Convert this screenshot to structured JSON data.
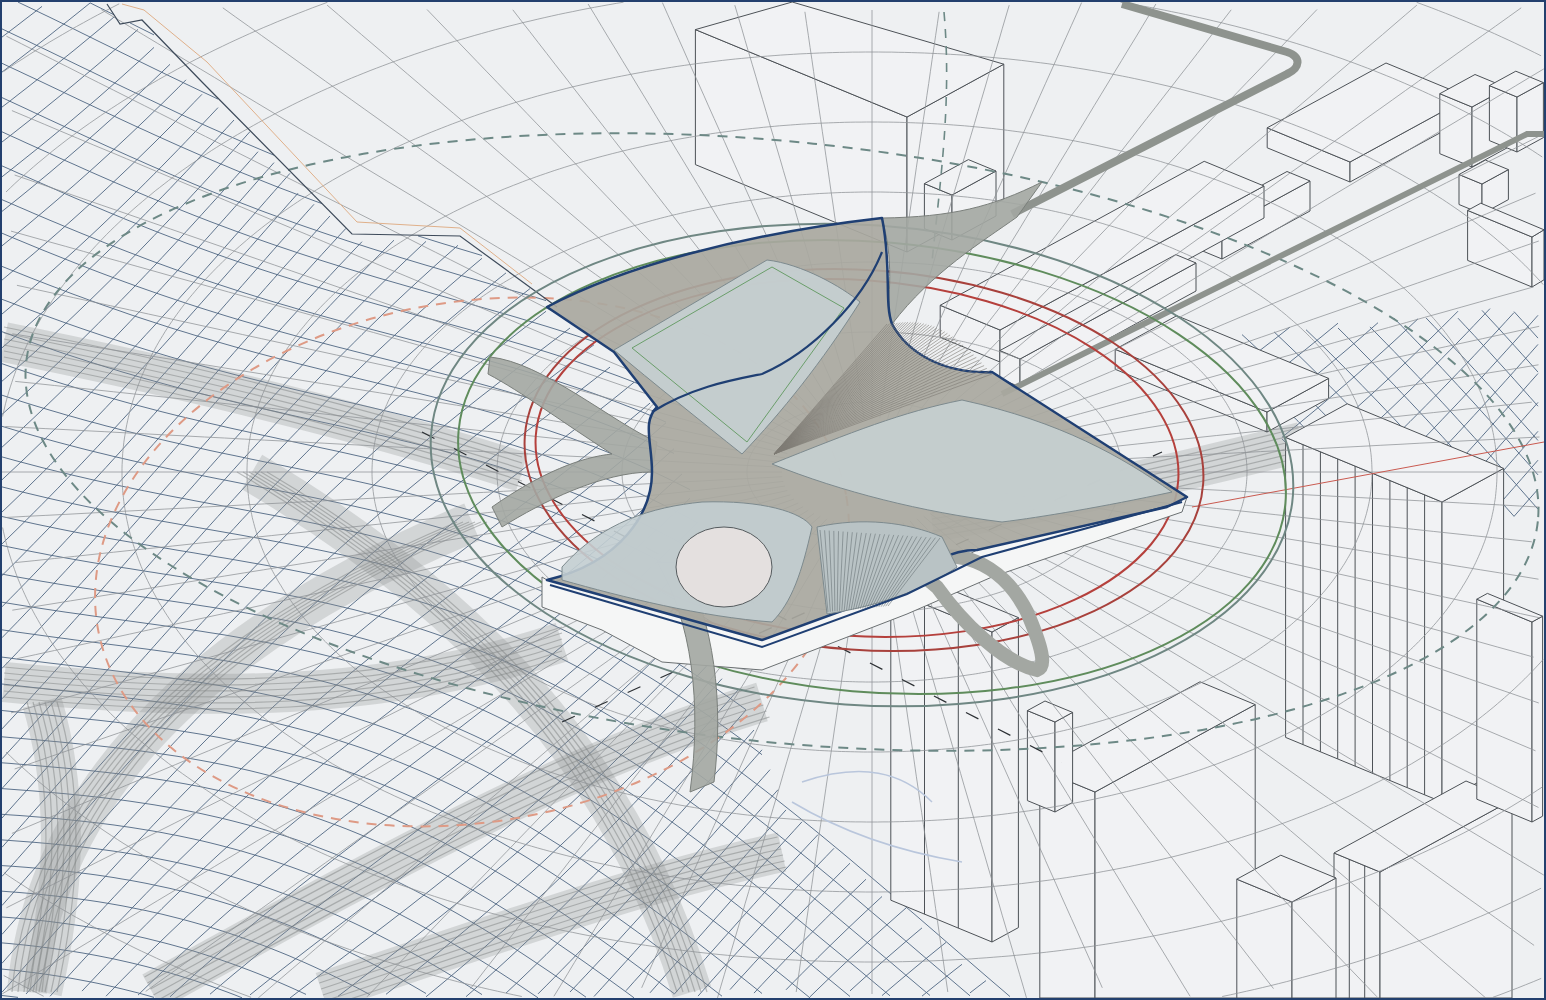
{
  "rings": [
    {
      "color": "#b5403c"
    },
    {
      "color": "#a8413c"
    },
    {
      "color": "#5f8c5c"
    },
    {
      "color": "#6f8783"
    }
  ],
  "dashed_rings": [
    {
      "color": "#6d8986"
    },
    {
      "color": "#de9a85"
    }
  ]
}
